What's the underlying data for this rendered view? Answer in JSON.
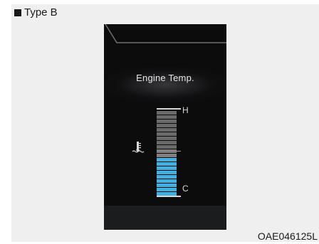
{
  "header": {
    "label": "Type B"
  },
  "display": {
    "title": "Engine Temp.",
    "gauge": {
      "high_label": "H",
      "low_label": "C",
      "total_segments": 20,
      "lit_segments": 9,
      "level_fraction": 0.45
    },
    "colors": {
      "lit": "#43b0e2",
      "dim": "#6a6a6a",
      "mid": "#808080"
    },
    "icon": "coolant-temperature-icon"
  },
  "figure": {
    "code": "OAE046125L"
  }
}
